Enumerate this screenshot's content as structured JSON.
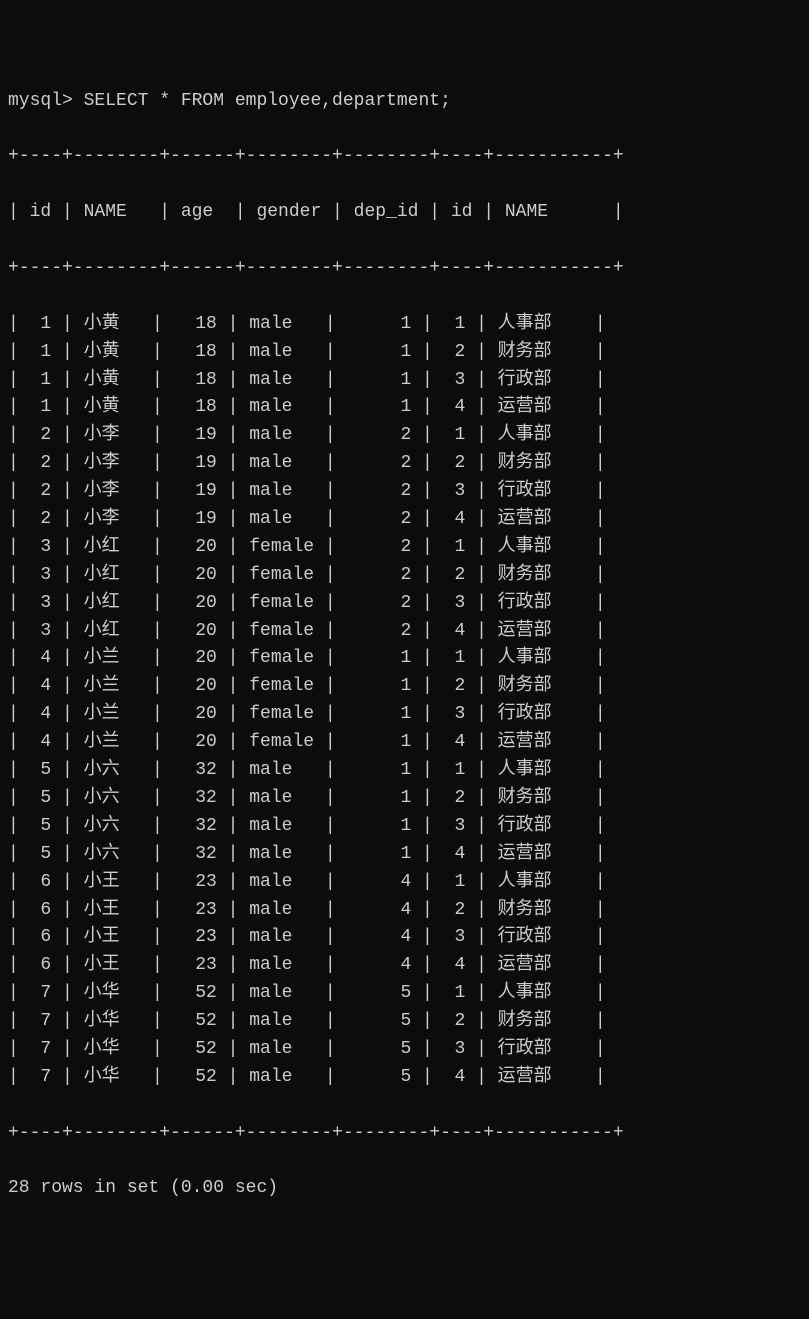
{
  "prompt": "mysql> SELECT * FROM employee,department;",
  "columns": [
    "id",
    "NAME",
    "age",
    "gender",
    "dep_id",
    "id",
    "NAME"
  ],
  "rows": [
    {
      "id": 1,
      "name": "小黄",
      "age": 18,
      "gender": "male",
      "dep_id": 1,
      "did": 1,
      "dname": "人事部"
    },
    {
      "id": 1,
      "name": "小黄",
      "age": 18,
      "gender": "male",
      "dep_id": 1,
      "did": 2,
      "dname": "财务部"
    },
    {
      "id": 1,
      "name": "小黄",
      "age": 18,
      "gender": "male",
      "dep_id": 1,
      "did": 3,
      "dname": "行政部"
    },
    {
      "id": 1,
      "name": "小黄",
      "age": 18,
      "gender": "male",
      "dep_id": 1,
      "did": 4,
      "dname": "运营部"
    },
    {
      "id": 2,
      "name": "小李",
      "age": 19,
      "gender": "male",
      "dep_id": 2,
      "did": 1,
      "dname": "人事部"
    },
    {
      "id": 2,
      "name": "小李",
      "age": 19,
      "gender": "male",
      "dep_id": 2,
      "did": 2,
      "dname": "财务部"
    },
    {
      "id": 2,
      "name": "小李",
      "age": 19,
      "gender": "male",
      "dep_id": 2,
      "did": 3,
      "dname": "行政部"
    },
    {
      "id": 2,
      "name": "小李",
      "age": 19,
      "gender": "male",
      "dep_id": 2,
      "did": 4,
      "dname": "运营部"
    },
    {
      "id": 3,
      "name": "小红",
      "age": 20,
      "gender": "female",
      "dep_id": 2,
      "did": 1,
      "dname": "人事部"
    },
    {
      "id": 3,
      "name": "小红",
      "age": 20,
      "gender": "female",
      "dep_id": 2,
      "did": 2,
      "dname": "财务部"
    },
    {
      "id": 3,
      "name": "小红",
      "age": 20,
      "gender": "female",
      "dep_id": 2,
      "did": 3,
      "dname": "行政部"
    },
    {
      "id": 3,
      "name": "小红",
      "age": 20,
      "gender": "female",
      "dep_id": 2,
      "did": 4,
      "dname": "运营部"
    },
    {
      "id": 4,
      "name": "小兰",
      "age": 20,
      "gender": "female",
      "dep_id": 1,
      "did": 1,
      "dname": "人事部"
    },
    {
      "id": 4,
      "name": "小兰",
      "age": 20,
      "gender": "female",
      "dep_id": 1,
      "did": 2,
      "dname": "财务部"
    },
    {
      "id": 4,
      "name": "小兰",
      "age": 20,
      "gender": "female",
      "dep_id": 1,
      "did": 3,
      "dname": "行政部"
    },
    {
      "id": 4,
      "name": "小兰",
      "age": 20,
      "gender": "female",
      "dep_id": 1,
      "did": 4,
      "dname": "运营部"
    },
    {
      "id": 5,
      "name": "小六",
      "age": 32,
      "gender": "male",
      "dep_id": 1,
      "did": 1,
      "dname": "人事部"
    },
    {
      "id": 5,
      "name": "小六",
      "age": 32,
      "gender": "male",
      "dep_id": 1,
      "did": 2,
      "dname": "财务部"
    },
    {
      "id": 5,
      "name": "小六",
      "age": 32,
      "gender": "male",
      "dep_id": 1,
      "did": 3,
      "dname": "行政部"
    },
    {
      "id": 5,
      "name": "小六",
      "age": 32,
      "gender": "male",
      "dep_id": 1,
      "did": 4,
      "dname": "运营部"
    },
    {
      "id": 6,
      "name": "小王",
      "age": 23,
      "gender": "male",
      "dep_id": 4,
      "did": 1,
      "dname": "人事部"
    },
    {
      "id": 6,
      "name": "小王",
      "age": 23,
      "gender": "male",
      "dep_id": 4,
      "did": 2,
      "dname": "财务部"
    },
    {
      "id": 6,
      "name": "小王",
      "age": 23,
      "gender": "male",
      "dep_id": 4,
      "did": 3,
      "dname": "行政部"
    },
    {
      "id": 6,
      "name": "小王",
      "age": 23,
      "gender": "male",
      "dep_id": 4,
      "did": 4,
      "dname": "运营部"
    },
    {
      "id": 7,
      "name": "小华",
      "age": 52,
      "gender": "male",
      "dep_id": 5,
      "did": 1,
      "dname": "人事部"
    },
    {
      "id": 7,
      "name": "小华",
      "age": 52,
      "gender": "male",
      "dep_id": 5,
      "did": 2,
      "dname": "财务部"
    },
    {
      "id": 7,
      "name": "小华",
      "age": 52,
      "gender": "male",
      "dep_id": 5,
      "did": 3,
      "dname": "行政部"
    },
    {
      "id": 7,
      "name": "小华",
      "age": 52,
      "gender": "male",
      "dep_id": 5,
      "did": 4,
      "dname": "运营部"
    }
  ],
  "footer": "28 rows in set (0.00 sec)",
  "border": "+----+--------+------+--------+--------+----+-----------+",
  "header_row": "| id | NAME   | age  | gender | dep_id | id | NAME      |"
}
